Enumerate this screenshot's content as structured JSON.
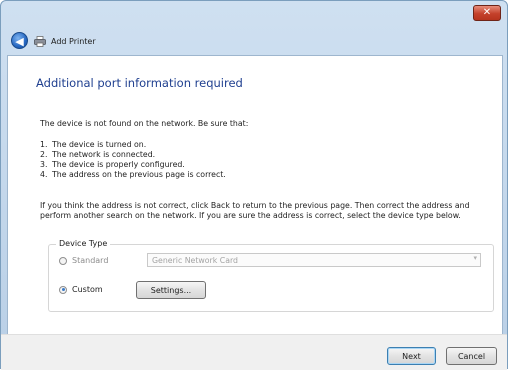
{
  "window": {
    "title": "Add Printer",
    "close_glyph": "✕"
  },
  "nav": {
    "back_glyph": "◀"
  },
  "content": {
    "heading": "Additional port information required",
    "intro": "The device is not found on the network.  Be sure that:",
    "steps": [
      {
        "num": "1.",
        "text": "The device is turned on."
      },
      {
        "num": "2.",
        "text": "The network is connected."
      },
      {
        "num": "3.",
        "text": "The device is properly configured."
      },
      {
        "num": "4.",
        "text": "The address on the previous page is correct."
      }
    ],
    "instructions": "If you think the address is not correct, click Back to return to the previous page.  Then correct the address and perform another search on the network.  If you are sure the address is correct, select the device type below."
  },
  "device_type": {
    "legend": "Device Type",
    "standard_label": "Standard",
    "standard_checked": false,
    "custom_label": "Custom",
    "custom_checked": true,
    "standard_select_value": "Generic Network Card",
    "settings_label": "Settings..."
  },
  "footer": {
    "next_label": "Next",
    "cancel_label": "Cancel"
  },
  "icons": {
    "back": "back-arrow-icon",
    "printer": "printer-icon",
    "close": "close-icon",
    "dropdown": "chevron-down-icon"
  },
  "colors": {
    "heading": "#1f3f8f",
    "close_button": "#c4412b",
    "title_bar": "#cfe0f1"
  }
}
